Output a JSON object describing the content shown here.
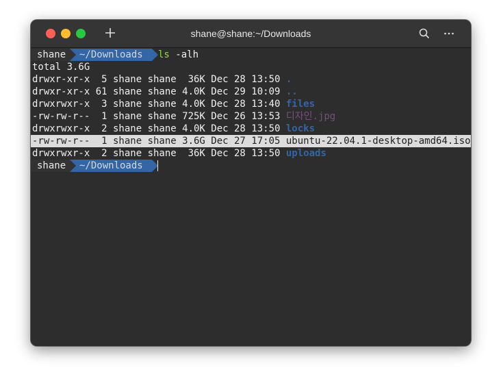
{
  "window": {
    "title": "shane@shane:~/Downloads"
  },
  "titlebar": {
    "traffic_lights": [
      {
        "name": "close",
        "color": "#ff5f57"
      },
      {
        "name": "minimize",
        "color": "#febc2e"
      },
      {
        "name": "maximize",
        "color": "#28c840"
      }
    ],
    "new_tab_icon": "plus-icon",
    "search_icon": "search-icon",
    "more_icon": "more-icon"
  },
  "colors": {
    "background": "#2d2d2d",
    "prompt_dir_bg": "#3465a4",
    "directory": "#3465a4",
    "image_file": "#75507b",
    "command": "#8ae234",
    "highlight": "#dcdcdc"
  },
  "terminal": {
    "prompt1": {
      "user": "shane",
      "dir": "~/Downloads",
      "command": "ls",
      "args": " -alh"
    },
    "total": "total 3.6G",
    "rows": [
      {
        "perms_info": "drwxr-xr-x  5 shane shane  36K Dec 28 13:50 ",
        "name": ".",
        "type": "dir",
        "highlighted": false
      },
      {
        "perms_info": "drwxr-xr-x 61 shane shane 4.0K Dec 29 10:09 ",
        "name": "..",
        "type": "dir",
        "highlighted": false
      },
      {
        "perms_info": "drwxrwxr-x  3 shane shane 4.0K Dec 28 13:40 ",
        "name": "files",
        "type": "dir",
        "highlighted": false
      },
      {
        "perms_info": "-rw-rw-r--  1 shane shane 725K Dec 26 13:53 ",
        "name": "디자인.jpg",
        "type": "image",
        "highlighted": false
      },
      {
        "perms_info": "drwxrwxr-x  2 shane shane 4.0K Dec 28 13:50 ",
        "name": "locks",
        "type": "dir",
        "highlighted": false
      },
      {
        "perms_info": "-rw-rw-r--  1 shane shane 3.6G Dec 27 17:05 ",
        "name": "ubuntu-22.04.1-desktop-amd64.iso",
        "type": "file",
        "highlighted": true
      },
      {
        "perms_info": "drwxrwxr-x  2 shane shane  36K Dec 28 13:50 ",
        "name": "uploads",
        "type": "dir",
        "highlighted": false
      }
    ],
    "prompt2": {
      "user": "shane",
      "dir": "~/Downloads"
    }
  }
}
